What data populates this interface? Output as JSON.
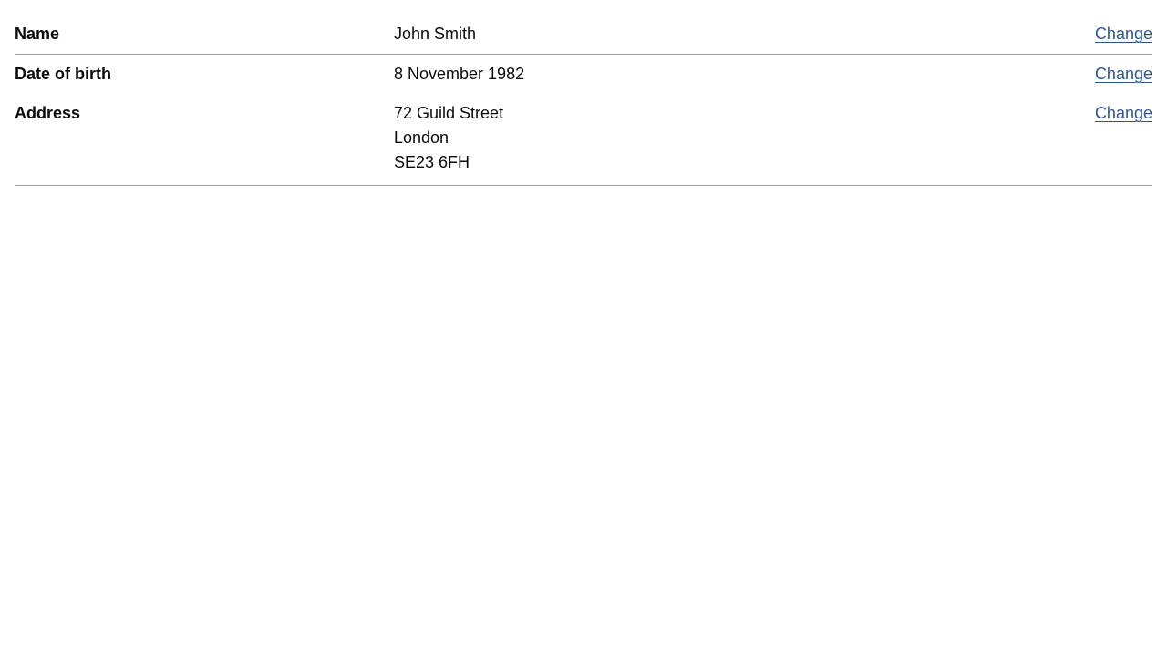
{
  "summary": {
    "rows": [
      {
        "key": "Name",
        "value_lines": [
          "John Smith"
        ],
        "action_label": "Change"
      },
      {
        "key": "Date of birth",
        "value_lines": [
          "8 November 1982"
        ],
        "action_label": "Change"
      },
      {
        "key": "Address",
        "value_lines": [
          "72 Guild Street",
          "London",
          "SE23 6FH"
        ],
        "action_label": "Change"
      }
    ]
  },
  "colors": {
    "text": "#0b0c0c",
    "link": "#2f5597",
    "divider": "#a0a0a0"
  }
}
